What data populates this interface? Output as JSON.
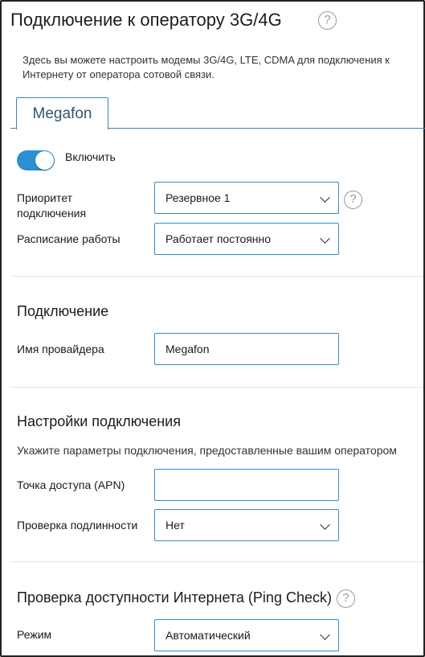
{
  "header": {
    "title": "Подключение к оператору 3G/4G",
    "help": "?",
    "description": "Здесь вы можете настроить модемы 3G/4G, LTE, CDMA для подключения к Интернету от оператора сотовой связи."
  },
  "tabs": [
    {
      "label": "Megafon"
    }
  ],
  "general": {
    "enable_label": "Включить",
    "enabled": true,
    "priority_label": "Приоритет подключения",
    "priority_value": "Резервное 1",
    "schedule_label": "Расписание работы",
    "schedule_value": "Работает постоянно"
  },
  "connection": {
    "heading": "Подключение",
    "provider_label": "Имя провайдера",
    "provider_value": "Megafon"
  },
  "settings": {
    "heading": "Настройки подключения",
    "description": "Укажите параметры подключения, предоставленные вашим оператором",
    "apn_label": "Точка доступа (APN)",
    "apn_value": "",
    "auth_label": "Проверка подлинности",
    "auth_value": "Нет"
  },
  "ping_check": {
    "heading": "Проверка доступности Интернета (Ping Check)",
    "mode_label": "Режим",
    "mode_value": "Автоматический"
  },
  "colors": {
    "accent": "#2c8fd4",
    "tab_border": "#3a84b6",
    "divider": "#e1e6ea"
  }
}
